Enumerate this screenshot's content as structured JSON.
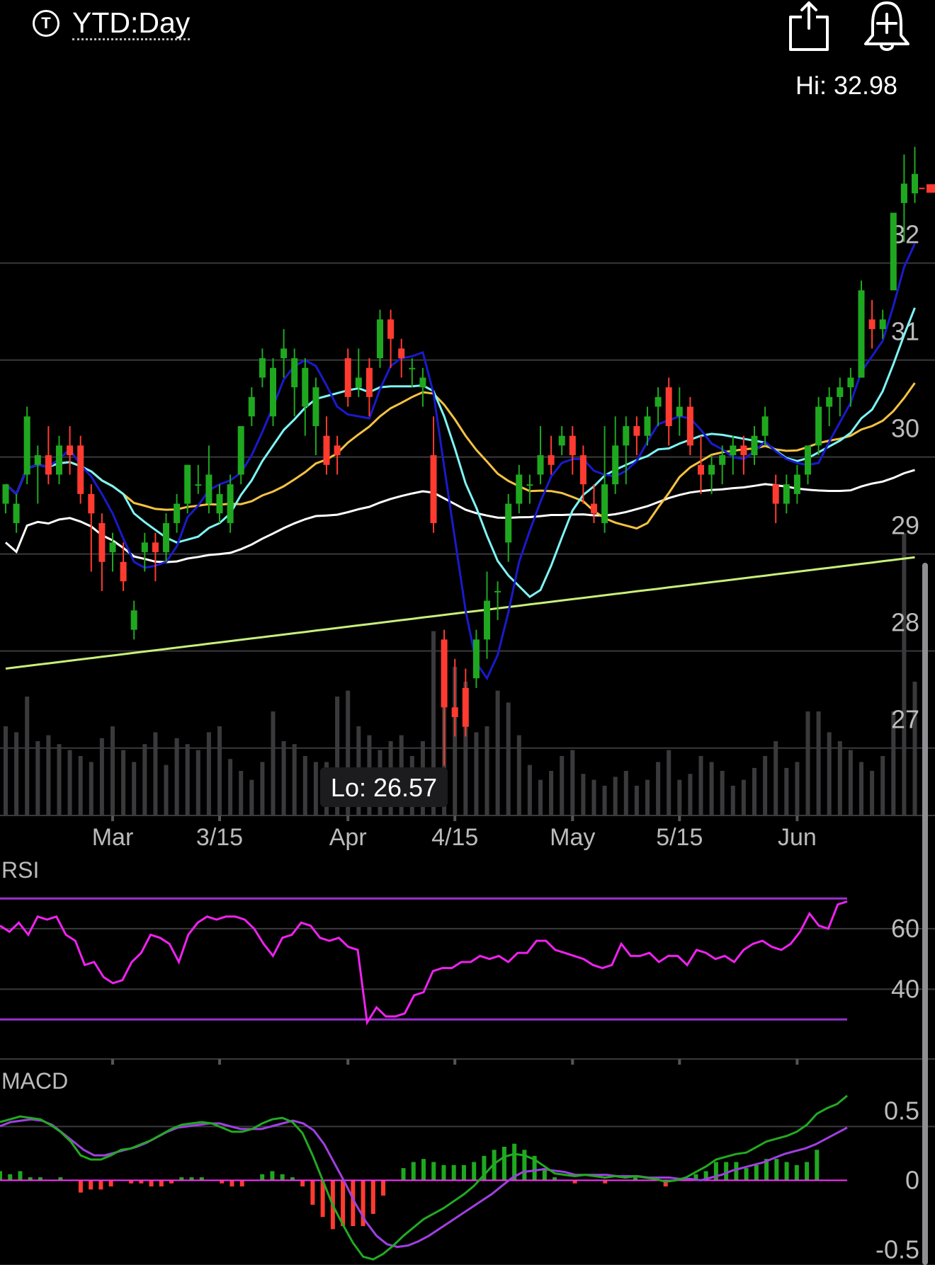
{
  "header": {
    "period_icon_text": "T",
    "period_label": "YTD:Day",
    "share_icon": "share-icon",
    "alert_icon": "bell-plus-icon"
  },
  "chart_data": {
    "type": "candlestick",
    "hi_label": "Hi: 32.98",
    "lo_label": "Lo: 26.57",
    "last_price_line": 32.55,
    "price_ylim": [
      26.1,
      33.8
    ],
    "price_ticks": [
      "32",
      "31",
      "30",
      "29",
      "28",
      "27"
    ],
    "price_tick_values": [
      32,
      31,
      30,
      29,
      28,
      27
    ],
    "x_labels": [
      "Mar",
      "3/15",
      "Apr",
      "4/15",
      "May",
      "5/15",
      "Jun"
    ],
    "x_label_index": [
      10,
      20,
      32,
      42,
      53,
      63,
      74
    ],
    "colors": {
      "up": "#1fa81f",
      "down": "#ff3b30",
      "volume": "#3a3a3c",
      "sma5": "#1a1acc",
      "sma10": "#7ff5f5",
      "sma20": "#f5c242",
      "sma50": "#ffffff",
      "sma100": "#c8f07a",
      "rsi": "#ee22ee",
      "rsi_band": "#9b30d0",
      "macd": "#22aa22",
      "signal": "#a040e0",
      "zero": "#ff30ff"
    },
    "candles": [
      [
        29.3,
        29.5,
        29.3,
        29.2
      ],
      [
        29.1,
        29.3,
        29.4,
        29.0
      ],
      [
        29.6,
        30.2,
        30.3,
        29.5
      ],
      [
        29.7,
        29.8,
        29.9,
        29.3
      ],
      [
        29.8,
        29.6,
        30.1,
        29.5
      ],
      [
        29.6,
        29.9,
        30.0,
        29.5
      ],
      [
        29.9,
        29.8,
        30.1,
        29.6
      ],
      [
        29.9,
        29.4,
        30.0,
        29.3
      ],
      [
        29.4,
        29.2,
        29.5,
        28.6
      ],
      [
        29.1,
        28.7,
        29.2,
        28.4
      ],
      [
        28.8,
        28.9,
        29.0,
        28.6
      ],
      [
        28.7,
        28.5,
        28.9,
        28.4
      ],
      [
        28.0,
        28.2,
        28.3,
        27.9
      ],
      [
        28.8,
        28.9,
        29.0,
        28.6
      ],
      [
        28.9,
        28.8,
        29.0,
        28.5
      ],
      [
        28.8,
        29.1,
        29.2,
        28.7
      ],
      [
        29.1,
        29.3,
        29.4,
        29.0
      ],
      [
        29.3,
        29.7,
        29.7,
        29.2
      ],
      [
        29.5,
        29.5,
        29.7,
        29.4
      ],
      [
        29.3,
        29.6,
        29.9,
        29.2
      ],
      [
        29.2,
        29.4,
        29.5,
        29.1
      ],
      [
        29.1,
        29.5,
        29.6,
        29.0
      ],
      [
        29.6,
        30.1,
        30.1,
        29.5
      ],
      [
        30.2,
        30.4,
        30.5,
        30.1
      ],
      [
        30.6,
        30.8,
        30.9,
        30.5
      ],
      [
        30.2,
        30.7,
        30.8,
        30.1
      ],
      [
        30.8,
        30.9,
        31.1,
        30.6
      ],
      [
        30.5,
        30.8,
        30.9,
        30.2
      ],
      [
        30.3,
        30.7,
        30.8,
        30.0
      ],
      [
        30.1,
        30.5,
        30.6,
        29.8
      ],
      [
        30.0,
        29.7,
        30.2,
        29.6
      ],
      [
        29.9,
        29.8,
        30.0,
        29.6
      ],
      [
        30.8,
        30.4,
        30.9,
        30.3
      ],
      [
        30.5,
        30.6,
        30.9,
        30.4
      ],
      [
        30.7,
        30.4,
        30.8,
        30.2
      ],
      [
        30.8,
        31.2,
        31.3,
        30.7
      ],
      [
        31.2,
        31.0,
        31.3,
        30.7
      ],
      [
        30.9,
        30.8,
        31.0,
        30.6
      ],
      [
        30.7,
        30.7,
        30.8,
        30.5
      ],
      [
        30.5,
        30.6,
        30.7,
        30.3
      ],
      [
        29.8,
        29.1,
        30.2,
        29.0
      ],
      [
        27.9,
        27.2,
        28.0,
        26.6
      ],
      [
        27.2,
        27.1,
        27.7,
        26.9
      ],
      [
        27.4,
        27.0,
        27.6,
        26.9
      ],
      [
        27.5,
        27.9,
        28.0,
        27.4
      ],
      [
        27.9,
        28.3,
        28.6,
        27.7
      ],
      [
        28.4,
        28.4,
        28.5,
        28.1
      ],
      [
        28.9,
        29.3,
        29.4,
        28.7
      ],
      [
        29.3,
        29.6,
        29.7,
        29.2
      ],
      [
        29.5,
        29.5,
        29.6,
        29.3
      ],
      [
        29.6,
        29.8,
        30.1,
        29.5
      ],
      [
        29.8,
        29.7,
        30.0,
        29.6
      ],
      [
        29.9,
        30.0,
        30.1,
        29.8
      ],
      [
        30.0,
        29.8,
        30.1,
        29.6
      ],
      [
        29.8,
        29.5,
        29.9,
        29.3
      ],
      [
        29.3,
        29.2,
        29.5,
        29.1
      ],
      [
        29.1,
        29.5,
        30.1,
        29.0
      ],
      [
        29.5,
        29.9,
        30.2,
        29.4
      ],
      [
        29.9,
        30.1,
        30.2,
        29.5
      ],
      [
        30.1,
        30.0,
        30.2,
        29.8
      ],
      [
        30.0,
        30.2,
        30.3,
        29.9
      ],
      [
        30.3,
        30.4,
        30.5,
        30.1
      ],
      [
        30.5,
        30.1,
        30.6,
        29.9
      ],
      [
        30.2,
        30.3,
        30.5,
        30.0
      ],
      [
        30.3,
        29.9,
        30.4,
        29.8
      ],
      [
        29.7,
        29.6,
        30.0,
        29.4
      ],
      [
        29.6,
        29.7,
        29.8,
        29.4
      ],
      [
        29.7,
        29.8,
        29.9,
        29.5
      ],
      [
        29.8,
        29.9,
        30.0,
        29.6
      ],
      [
        29.9,
        29.8,
        30.0,
        29.6
      ],
      [
        29.8,
        30.0,
        30.1,
        29.7
      ],
      [
        30.0,
        30.2,
        30.3,
        29.9
      ],
      [
        29.5,
        29.3,
        29.6,
        29.1
      ],
      [
        29.3,
        29.5,
        29.6,
        29.2
      ],
      [
        29.4,
        29.6,
        29.7,
        29.3
      ],
      [
        29.6,
        29.9,
        29.9,
        29.5
      ],
      [
        29.9,
        30.3,
        30.4,
        29.8
      ],
      [
        30.3,
        30.4,
        30.5,
        30.1
      ],
      [
        30.4,
        30.5,
        30.6,
        30.2
      ],
      [
        30.5,
        30.6,
        30.7,
        30.3
      ],
      [
        30.6,
        31.5,
        31.6,
        30.6
      ],
      [
        31.2,
        31.1,
        31.4,
        30.9
      ],
      [
        31.1,
        31.2,
        31.3,
        31.0
      ],
      [
        31.5,
        32.3,
        32.3,
        31.6
      ],
      [
        32.4,
        32.6,
        32.9,
        32.0
      ],
      [
        32.5,
        32.7,
        32.98,
        32.4
      ]
    ],
    "volume_ylim": [
      0,
      100
    ],
    "volume": [
      30,
      28,
      40,
      25,
      27,
      24,
      22,
      20,
      18,
      26,
      30,
      22,
      18,
      24,
      28,
      17,
      26,
      24,
      22,
      28,
      30,
      19,
      15,
      12,
      18,
      35,
      25,
      24,
      20,
      18,
      18,
      40,
      42,
      30,
      27,
      22,
      25,
      27,
      20,
      25,
      62,
      55,
      50,
      45,
      28,
      30,
      42,
      38,
      27,
      17,
      12,
      15,
      20,
      22,
      14,
      12,
      10,
      13,
      15,
      10,
      12,
      18,
      22,
      12,
      14,
      20,
      18,
      15,
      10,
      12,
      16,
      20,
      25,
      16,
      18,
      35,
      35,
      28,
      25,
      22,
      18,
      15,
      20,
      35,
      95,
      45,
      30
    ],
    "rsi": {
      "ylim": [
        16,
        78
      ],
      "ticks": [
        "60",
        "40"
      ],
      "tick_values": [
        60,
        40
      ],
      "upper_band": 70,
      "lower_band": 30,
      "values": [
        61,
        59,
        62,
        58,
        64,
        63,
        64,
        58,
        56,
        48,
        49,
        44,
        42,
        43,
        49,
        52,
        58,
        57,
        55,
        49,
        58,
        62,
        64,
        63,
        64,
        64,
        63,
        60,
        55,
        51,
        57,
        58,
        62,
        61,
        57,
        56,
        57,
        54,
        53,
        29,
        34,
        31,
        31,
        32,
        38,
        39,
        46,
        47,
        47,
        49,
        49,
        51,
        50,
        51,
        49,
        52,
        52,
        56,
        56,
        53,
        52,
        51,
        50,
        48,
        47,
        48,
        55,
        51,
        51,
        52,
        49,
        51,
        51,
        48,
        53,
        52,
        50,
        51,
        49,
        53,
        55,
        56,
        54,
        53,
        55,
        59,
        65,
        61,
        60,
        68,
        69
      ]
    },
    "macd": {
      "ylim": [
        -0.6,
        0.65
      ],
      "ticks": [
        "0.5",
        "0",
        "-0.5"
      ],
      "tick_values": [
        0.5,
        0,
        -0.5
      ],
      "macd": [
        0.42,
        0.44,
        0.46,
        0.45,
        0.44,
        0.4,
        0.35,
        0.28,
        0.18,
        0.15,
        0.15,
        0.18,
        0.22,
        0.23,
        0.26,
        0.29,
        0.33,
        0.37,
        0.4,
        0.41,
        0.42,
        0.41,
        0.38,
        0.35,
        0.35,
        0.37,
        0.41,
        0.44,
        0.45,
        0.42,
        0.34,
        0.18,
        0.0,
        -0.18,
        -0.32,
        -0.45,
        -0.55,
        -0.57,
        -0.53,
        -0.47,
        -0.4,
        -0.34,
        -0.28,
        -0.24,
        -0.2,
        -0.15,
        -0.1,
        -0.04,
        0.04,
        0.12,
        0.17,
        0.19,
        0.18,
        0.15,
        0.1,
        0.05,
        0.04,
        0.03,
        0.04,
        0.03,
        0.02,
        0.03,
        0.02,
        0.03,
        0.02,
        0.01,
        -0.01,
        0.0,
        0.02,
        0.06,
        0.1,
        0.15,
        0.17,
        0.19,
        0.2,
        0.24,
        0.28,
        0.3,
        0.32,
        0.35,
        0.4,
        0.48,
        0.52,
        0.55,
        0.61
      ]
    },
    "signal": [
      0.39,
      0.42,
      0.43,
      0.44,
      0.43,
      0.4,
      0.34,
      0.28,
      0.22,
      0.18,
      0.18,
      0.2,
      0.22,
      0.24,
      0.27,
      0.31,
      0.35,
      0.38,
      0.39,
      0.4,
      0.41,
      0.41,
      0.39,
      0.37,
      0.37,
      0.37,
      0.39,
      0.41,
      0.43,
      0.41,
      0.36,
      0.26,
      0.12,
      -0.02,
      -0.17,
      -0.3,
      -0.4,
      -0.46,
      -0.48,
      -0.47,
      -0.44,
      -0.4,
      -0.35,
      -0.3,
      -0.25,
      -0.2,
      -0.15,
      -0.1,
      -0.04,
      0.02,
      0.06,
      0.07,
      0.08,
      0.07,
      0.06,
      0.04,
      0.04,
      0.04,
      0.04,
      0.03,
      0.03,
      0.03,
      0.02,
      0.02,
      0.02,
      0.01,
      0.01,
      0.0,
      0.02,
      0.04,
      0.07,
      0.09,
      0.11,
      0.13,
      0.16,
      0.19,
      0.21,
      0.23,
      0.26,
      0.3,
      0.34,
      0.38
    ],
    "sma": {
      "sma5": [
        29.2,
        29.4,
        29.7,
        29.9,
        29.7,
        29.5,
        29.5,
        29.6,
        29.4,
        29.2,
        28.9,
        28.9,
        28.7,
        28.6,
        28.6,
        28.7,
        28.8,
        28.9,
        29.1,
        29.3,
        29.4,
        29.6,
        29.8,
        30.0,
        30.2,
        30.3,
        30.5,
        30.7,
        30.8,
        30.7,
        30.4,
        30.3,
        30.1,
        30.1,
        30.4,
        30.6,
        30.7,
        30.8,
        30.7,
        30.7,
        30.6,
        29.8,
        29.0,
        28.0,
        27.6,
        27.5,
        27.6,
        28.0,
        28.5,
        28.7,
        29.0,
        29.3,
        29.3,
        29.3,
        29.5,
        29.6,
        29.6,
        29.7,
        29.8,
        29.9,
        30.0,
        30.0,
        29.9,
        29.8,
        29.7,
        29.7,
        29.6,
        29.6,
        29.7,
        29.7,
        29.7,
        29.6,
        29.6,
        29.5,
        29.6,
        29.8,
        30.0,
        30.2,
        30.4,
        30.4,
        30.5,
        30.6,
        31.0,
        31.5,
        32.0,
        32.4
      ]
    },
    "sma_note_hidden": ""
  }
}
